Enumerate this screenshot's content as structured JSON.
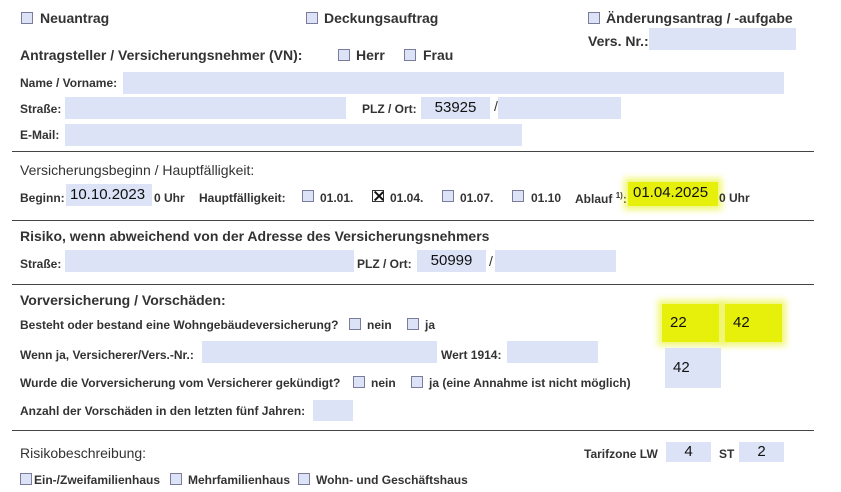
{
  "top": {
    "neuantrag": "Neuantrag",
    "deckungsauftrag": "Deckungsauftrag",
    "aenderungsantrag": "Änderungsantrag / -aufgabe",
    "vers_nr_label": "Vers. Nr.:",
    "vers_nr_value": ""
  },
  "applicant": {
    "heading": "Antragsteller / Versicherungsnehmer (VN):",
    "herr": "Herr",
    "frau": "Frau",
    "name_label": "Name / Vorname:",
    "name_value": "",
    "strasse_label": "Straße:",
    "strasse_value": "",
    "plz_ort_label": "PLZ / Ort:",
    "plz_value": "53925",
    "slash": "/",
    "ort_value": "",
    "email_label": "E-Mail:",
    "email_value": ""
  },
  "start": {
    "heading": "Versicherungsbeginn / Hauptfälligkeit:",
    "beginn_label": "Beginn:",
    "beginn_value": "10.10.2023",
    "uhr": "0 Uhr",
    "hauptfaelligkeit_label": "Hauptfälligkeit:",
    "options": [
      "01.01.",
      "01.04.",
      "01.07.",
      "01.10"
    ],
    "checked_index": 1,
    "ablauf_label": "Ablauf",
    "ablauf_sup": "1)",
    "ablauf_colon": ":",
    "ablauf_value": "01.04.2025",
    "ablauf_uhr": "0 Uhr"
  },
  "risk": {
    "heading": "Risiko, wenn abweichend von der Adresse des Versicherungsnehmers",
    "strasse_label": "Straße:",
    "strasse_value": "",
    "plz_ort_label": "PLZ / Ort:",
    "plz_value": "50999",
    "slash": "/",
    "ort_value": ""
  },
  "prior": {
    "heading": "Vorversicherung / Vorschäden:",
    "q1": "Besteht oder bestand eine Wohngebäudeversicherung?",
    "nein": "nein",
    "ja": "ja",
    "q2_label": "Wenn ja, Versicherer/Vers.-Nr.:",
    "q2_value": "",
    "wert_label": "Wert 1914:",
    "wert_value": "",
    "q3": "Wurde die Vorversicherung vom Versicherer gekündigt?",
    "ja_note": "ja (eine Annahme ist nicht möglich)",
    "q4": "Anzahl der Vorschäden in den letzten fünf Jahren:",
    "q4_value": "",
    "side_field_1": "22",
    "side_field_2": "42",
    "side_field_3": "42"
  },
  "description": {
    "heading": "Risikobeschreibung:",
    "tarifzone_label": "Tarifzone LW",
    "tarifzone_lw_value": "4",
    "st_label": "ST",
    "st_value": "2",
    "types": [
      "Ein-/Zweifamilienhaus",
      "Mehrfamilienhaus",
      "Wohn- und Geschäftshaus"
    ]
  },
  "colors": {
    "field_bg": "#dde3f6",
    "highlight": "#e6f00a"
  }
}
